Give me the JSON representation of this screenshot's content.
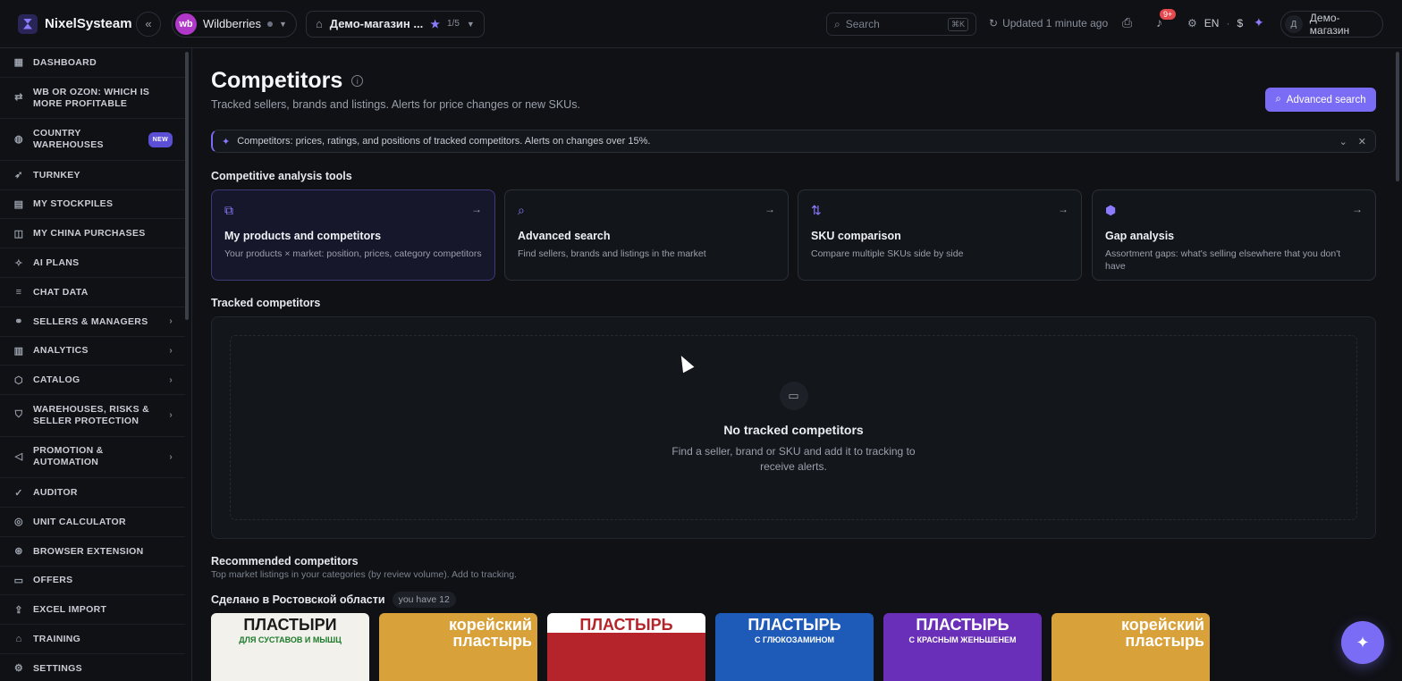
{
  "app": {
    "name": "NixelSysteam"
  },
  "header": {
    "collapse_label": "«",
    "marketplace": {
      "badge": "wb",
      "name": "Wildberries"
    },
    "store": {
      "name": "Демо-магазин ...",
      "count": "1/5"
    },
    "search": {
      "placeholder": "Search",
      "shortcut": "⌘K"
    },
    "updated": "Updated 1 minute ago",
    "notifications_badge": "9+",
    "language": "EN",
    "currency": "$",
    "user": {
      "initial": "Д",
      "name": "Демо-магазин"
    }
  },
  "sidebar": {
    "items": [
      {
        "label": "DASHBOARD",
        "icon": "grid-icon"
      },
      {
        "label": "WB OR OZON: WHICH IS MORE PROFITABLE",
        "icon": "compare-icon"
      },
      {
        "label": "COUNTRY WAREHOUSES",
        "icon": "globe-icon",
        "badge": "NEW"
      },
      {
        "label": "TURNKEY",
        "icon": "rocket-icon"
      },
      {
        "label": "MY STOCKPILES",
        "icon": "file-icon"
      },
      {
        "label": "MY CHINA PURCHASES",
        "icon": "bag-icon"
      },
      {
        "label": "AI PLANS",
        "icon": "sparkle-icon"
      },
      {
        "label": "CHAT DATA",
        "icon": "database-icon"
      },
      {
        "label": "SELLERS & MANAGERS",
        "icon": "handshake-icon"
      },
      {
        "label": "ANALYTICS",
        "icon": "bar-chart-icon"
      },
      {
        "label": "CATALOG",
        "icon": "box-icon"
      },
      {
        "label": "WAREHOUSES, RISKS & SELLER PROTECTION",
        "icon": "shield-icon"
      },
      {
        "label": "PROMOTION & AUTOMATION",
        "icon": "megaphone-icon"
      },
      {
        "label": "AUDITOR",
        "icon": "check-circle-icon"
      },
      {
        "label": "UNIT CALCULATOR",
        "icon": "target-icon"
      },
      {
        "label": "BROWSER EXTENSION",
        "icon": "extension-icon"
      },
      {
        "label": "OFFERS",
        "icon": "chat-icon"
      },
      {
        "label": "EXCEL IMPORT",
        "icon": "upload-icon"
      },
      {
        "label": "TRAINING",
        "icon": "graduation-icon"
      },
      {
        "label": "SETTINGS",
        "icon": "gear-icon"
      }
    ]
  },
  "page": {
    "title": "Competitors",
    "subtitle": "Tracked sellers, brands and listings. Alerts for price changes or new SKUs.",
    "advanced_search_button": "Advanced search",
    "banner": "Competitors: prices, ratings, and positions of tracked competitors. Alerts on changes over 15%.",
    "tools_heading": "Competitive analysis tools",
    "tools": [
      {
        "title": "My products and competitors",
        "desc": "Your products × market: position, prices, category competitors",
        "icon": "cubes-icon"
      },
      {
        "title": "Advanced search",
        "desc": "Find sellers, brands and listings in the market",
        "icon": "search-icon"
      },
      {
        "title": "SKU comparison",
        "desc": "Compare multiple SKUs side by side",
        "icon": "compare-icon"
      },
      {
        "title": "Gap analysis",
        "desc": "Assortment gaps: what's selling elsewhere that you don't have",
        "icon": "package-search-icon"
      }
    ],
    "tracked_heading": "Tracked competitors",
    "empty": {
      "title": "No tracked competitors",
      "desc": "Find a seller, brand or SKU and add it to tracking to receive alerts."
    },
    "recommended": {
      "heading": "Recommended competitors",
      "subtitle": "Top market listings in your categories (by review volume). Add to tracking.",
      "region": "Сделано в Ростовской области",
      "region_badge": "you have 12"
    },
    "products": [
      {
        "text": "ПЛАСТЫРИ",
        "sub": "ДЛЯ СУСТАВОВ И МЫШЦ",
        "bg": "#f3f1ec",
        "fg": "#1a1a1a"
      },
      {
        "text": "корейский пластырь",
        "sub": "",
        "bg": "#d9a13a",
        "fg": "#ffffff"
      },
      {
        "text": "ПЛАСТЫРЬ",
        "sub": "",
        "bg": "#b4242a",
        "fg": "#ffffff"
      },
      {
        "text": "ПЛАСТЫРЬ",
        "sub": "С ГЛЮКОЗАМИНОМ",
        "bg": "#1e5bb8",
        "fg": "#ffffff"
      },
      {
        "text": "ПЛАСТЫРЬ",
        "sub": "С КРАСНЫМ ЖЕНЬШЕНЕМ",
        "bg": "#6a2fb8",
        "fg": "#ffffff"
      },
      {
        "text": "корейский пластырь",
        "sub": "",
        "bg": "#d9a13a",
        "fg": "#ffffff"
      }
    ]
  }
}
